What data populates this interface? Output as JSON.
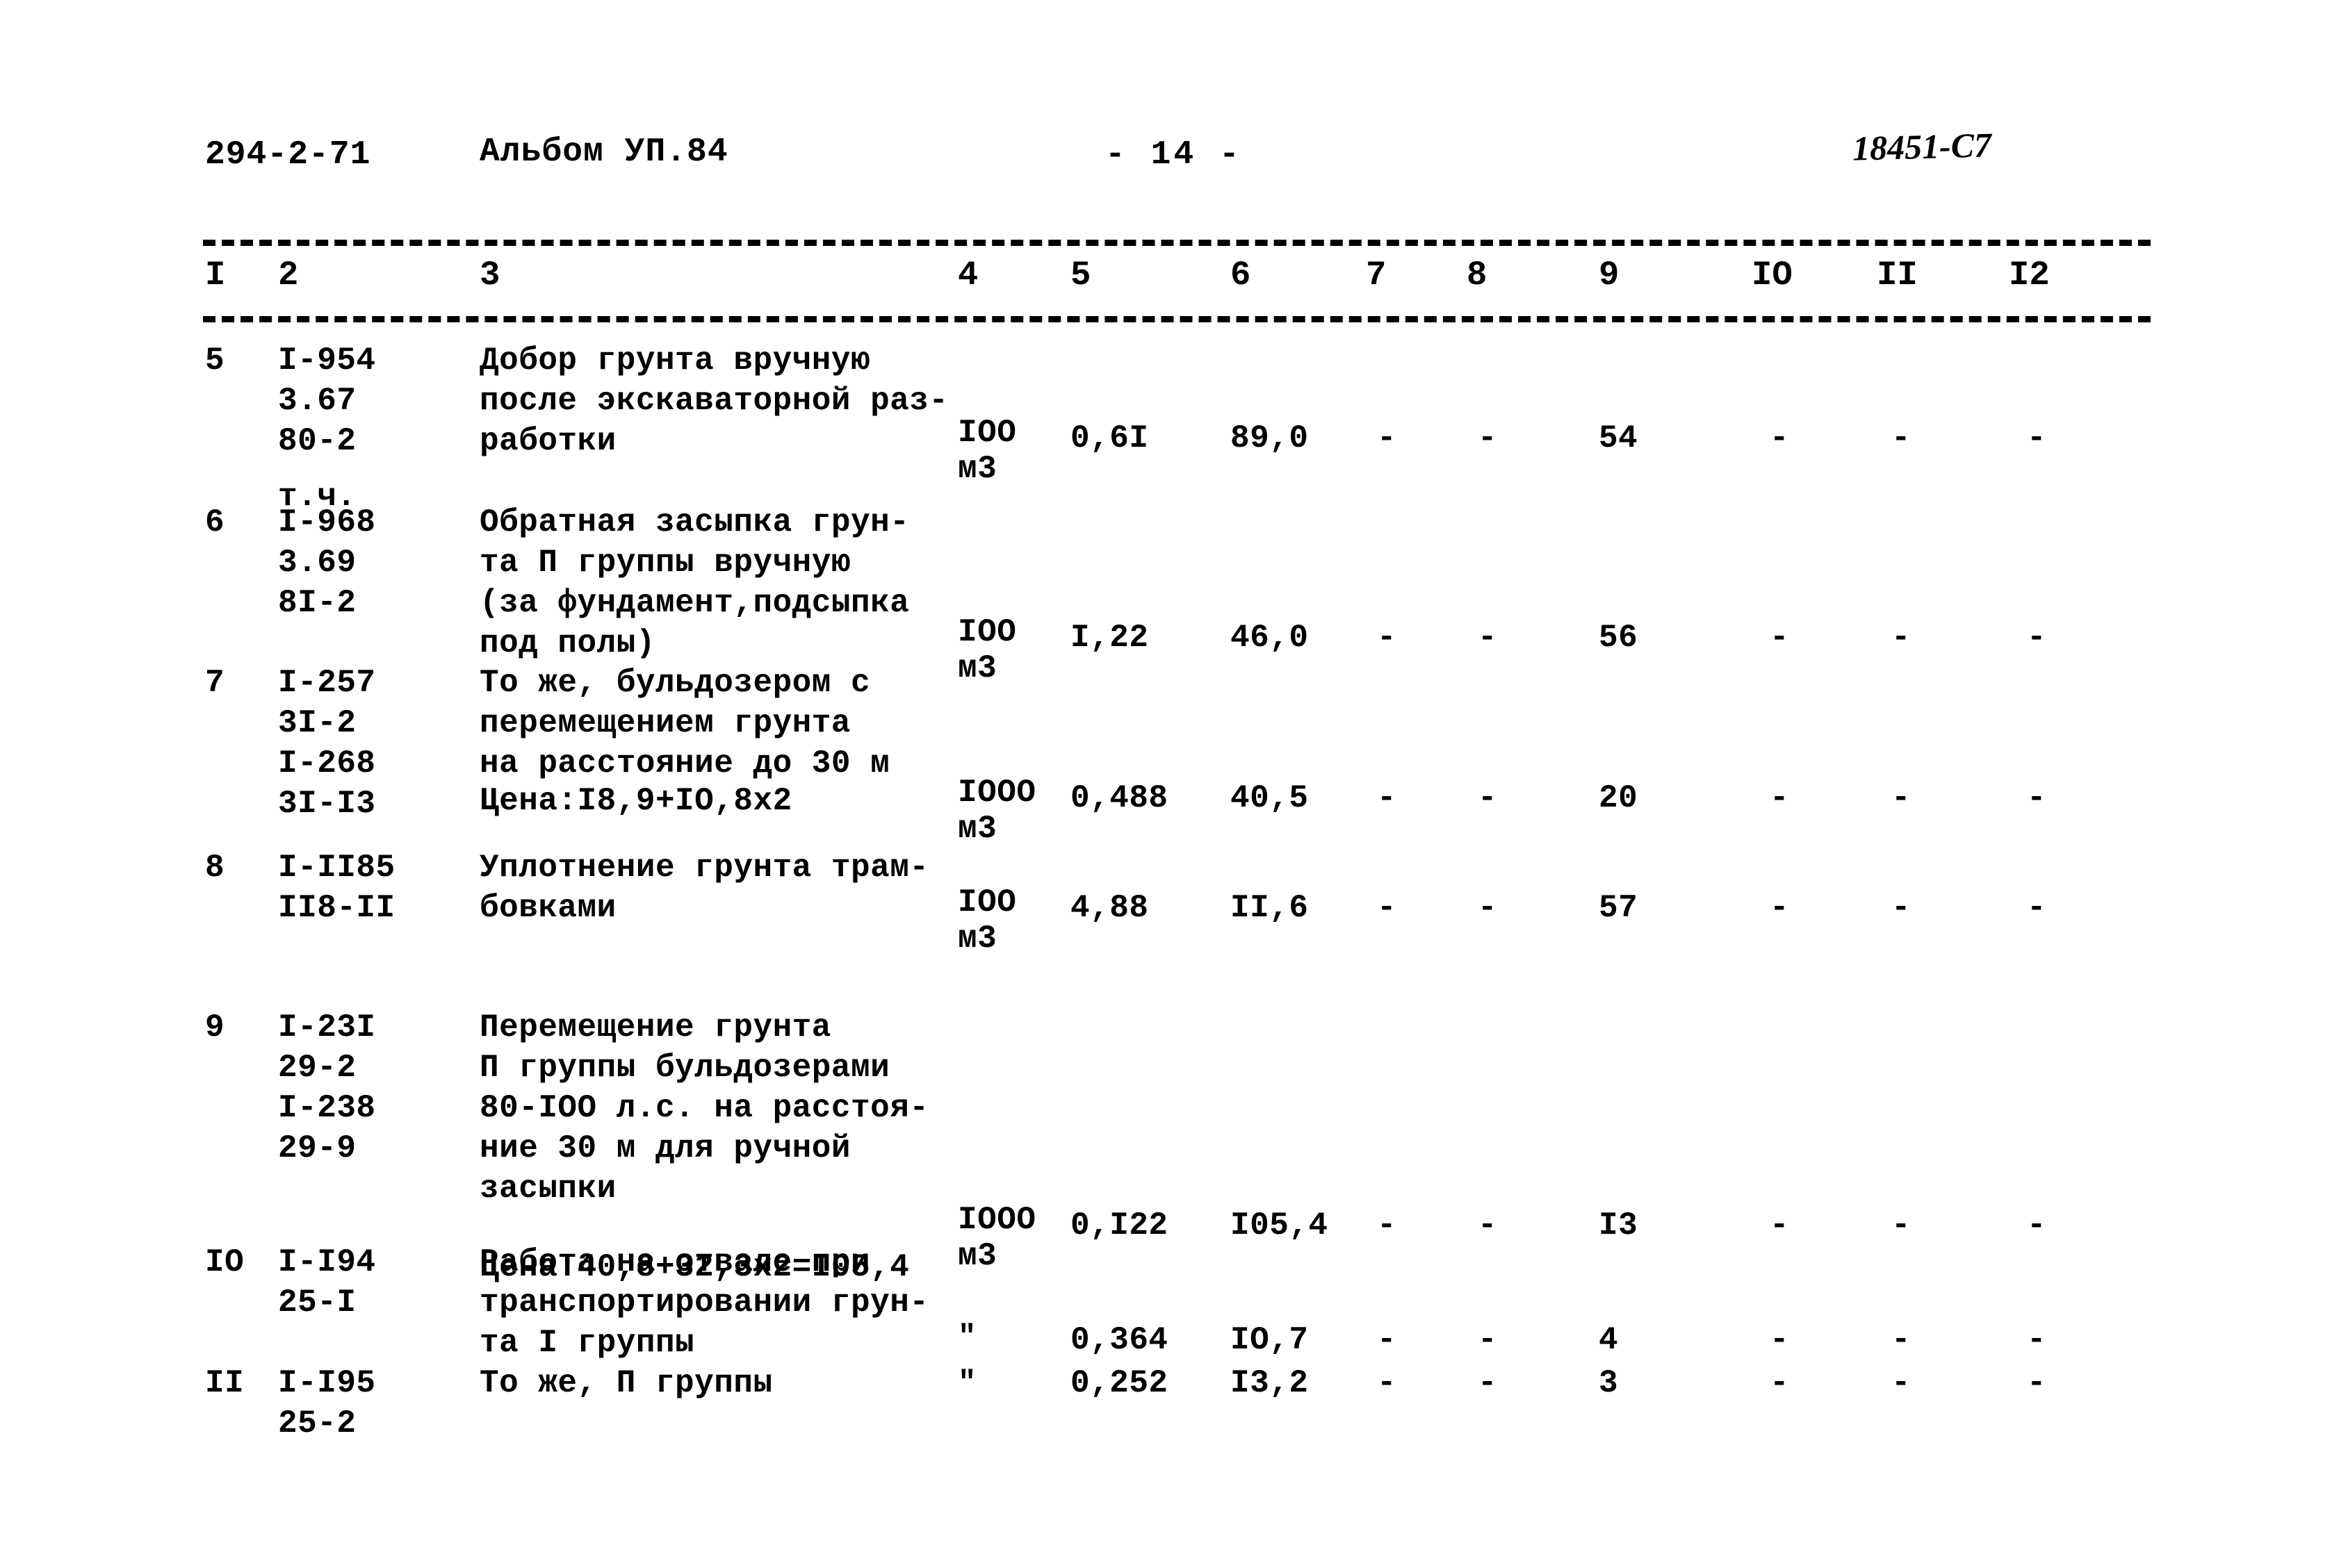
{
  "header": {
    "doc_code": "294-2-71",
    "album": "Альбом УП.84",
    "page_marker": "- 14 -",
    "stamp": "18451-С7"
  },
  "table": {
    "column_numbers": [
      "I",
      "2",
      "3",
      "4",
      "5",
      "6",
      "7",
      "8",
      "9",
      "IO",
      "II",
      "I2"
    ],
    "rows": [
      {
        "num": "5",
        "codes": [
          "I-954",
          "3.67",
          "80-2",
          "т.ч."
        ],
        "desc": [
          "Добор грунта вручную",
          "после экскаваторной раз-",
          "работки"
        ],
        "unit": [
          "IOO",
          "м3"
        ],
        "c5": "0,6I",
        "c6": "89,0",
        "c7": "-",
        "c8": "-",
        "c9": "54",
        "c10": "-",
        "c11": "-",
        "c12": "-",
        "price": ""
      },
      {
        "num": "6",
        "codes": [
          "I-968",
          "3.69",
          "8I-2"
        ],
        "desc": [
          "Обратная засыпка грун-",
          "та П группы вручную",
          "(за фундамент,подсыпка",
          "под полы)"
        ],
        "unit": [
          "IOO",
          "м3"
        ],
        "c5": "I,22",
        "c6": "46,0",
        "c7": "-",
        "c8": "-",
        "c9": "56",
        "c10": "-",
        "c11": "-",
        "c12": "-",
        "price": ""
      },
      {
        "num": "7",
        "codes": [
          "I-257",
          "3I-2",
          "I-268",
          "3I-I3"
        ],
        "desc": [
          "То же, бульдозером с",
          "перемещением грунта",
          "на расстояние до 30 м"
        ],
        "unit": [
          "IOOO",
          "м3"
        ],
        "c5": "0,488",
        "c6": "40,5",
        "c7": "-",
        "c8": "-",
        "c9": "20",
        "c10": "-",
        "c11": "-",
        "c12": "-",
        "price": "Цена:I8,9+IO,8x2"
      },
      {
        "num": "8",
        "codes": [
          "I-II85",
          "II8-II"
        ],
        "desc": [
          "Уплотнение грунта трам-",
          "бовками"
        ],
        "unit": [
          "IOO",
          "м3"
        ],
        "c5": "4,88",
        "c6": "II,6",
        "c7": "-",
        "c8": "-",
        "c9": "57",
        "c10": "-",
        "c11": "-",
        "c12": "-",
        "price": ""
      },
      {
        "num": "9",
        "codes": [
          "I-23I",
          "29-2",
          "I-238",
          "29-9"
        ],
        "desc": [
          "Перемещение грунта",
          "П группы бульдозерами",
          "80-IOO л.с. на расстоя-",
          "ние 30 м для ручной",
          "засыпки"
        ],
        "unit": [
          "IOOO",
          "м3"
        ],
        "c5": "0,I22",
        "c6": "I05,4",
        "c7": "-",
        "c8": "-",
        "c9": "I3",
        "c10": "-",
        "c11": "-",
        "c12": "-",
        "price": "Цена:40,8+32,3x2=I05,4"
      },
      {
        "num": "IO",
        "codes": [
          "I-I94",
          "25-I"
        ],
        "desc": [
          "Работа на отвале при",
          "транспортировании грун-",
          "та I группы"
        ],
        "unit": [
          "\""
        ],
        "c5": "0,364",
        "c6": "IO,7",
        "c7": "-",
        "c8": "-",
        "c9": "4",
        "c10": "-",
        "c11": "-",
        "c12": "-",
        "price": ""
      },
      {
        "num": "II",
        "codes": [
          "I-I95",
          "25-2"
        ],
        "desc": [
          "То же, П группы"
        ],
        "unit": [
          "\""
        ],
        "c5": "0,252",
        "c6": "I3,2",
        "c7": "-",
        "c8": "-",
        "c9": "3",
        "c10": "-",
        "c11": "-",
        "c12": "-",
        "price": ""
      }
    ]
  }
}
